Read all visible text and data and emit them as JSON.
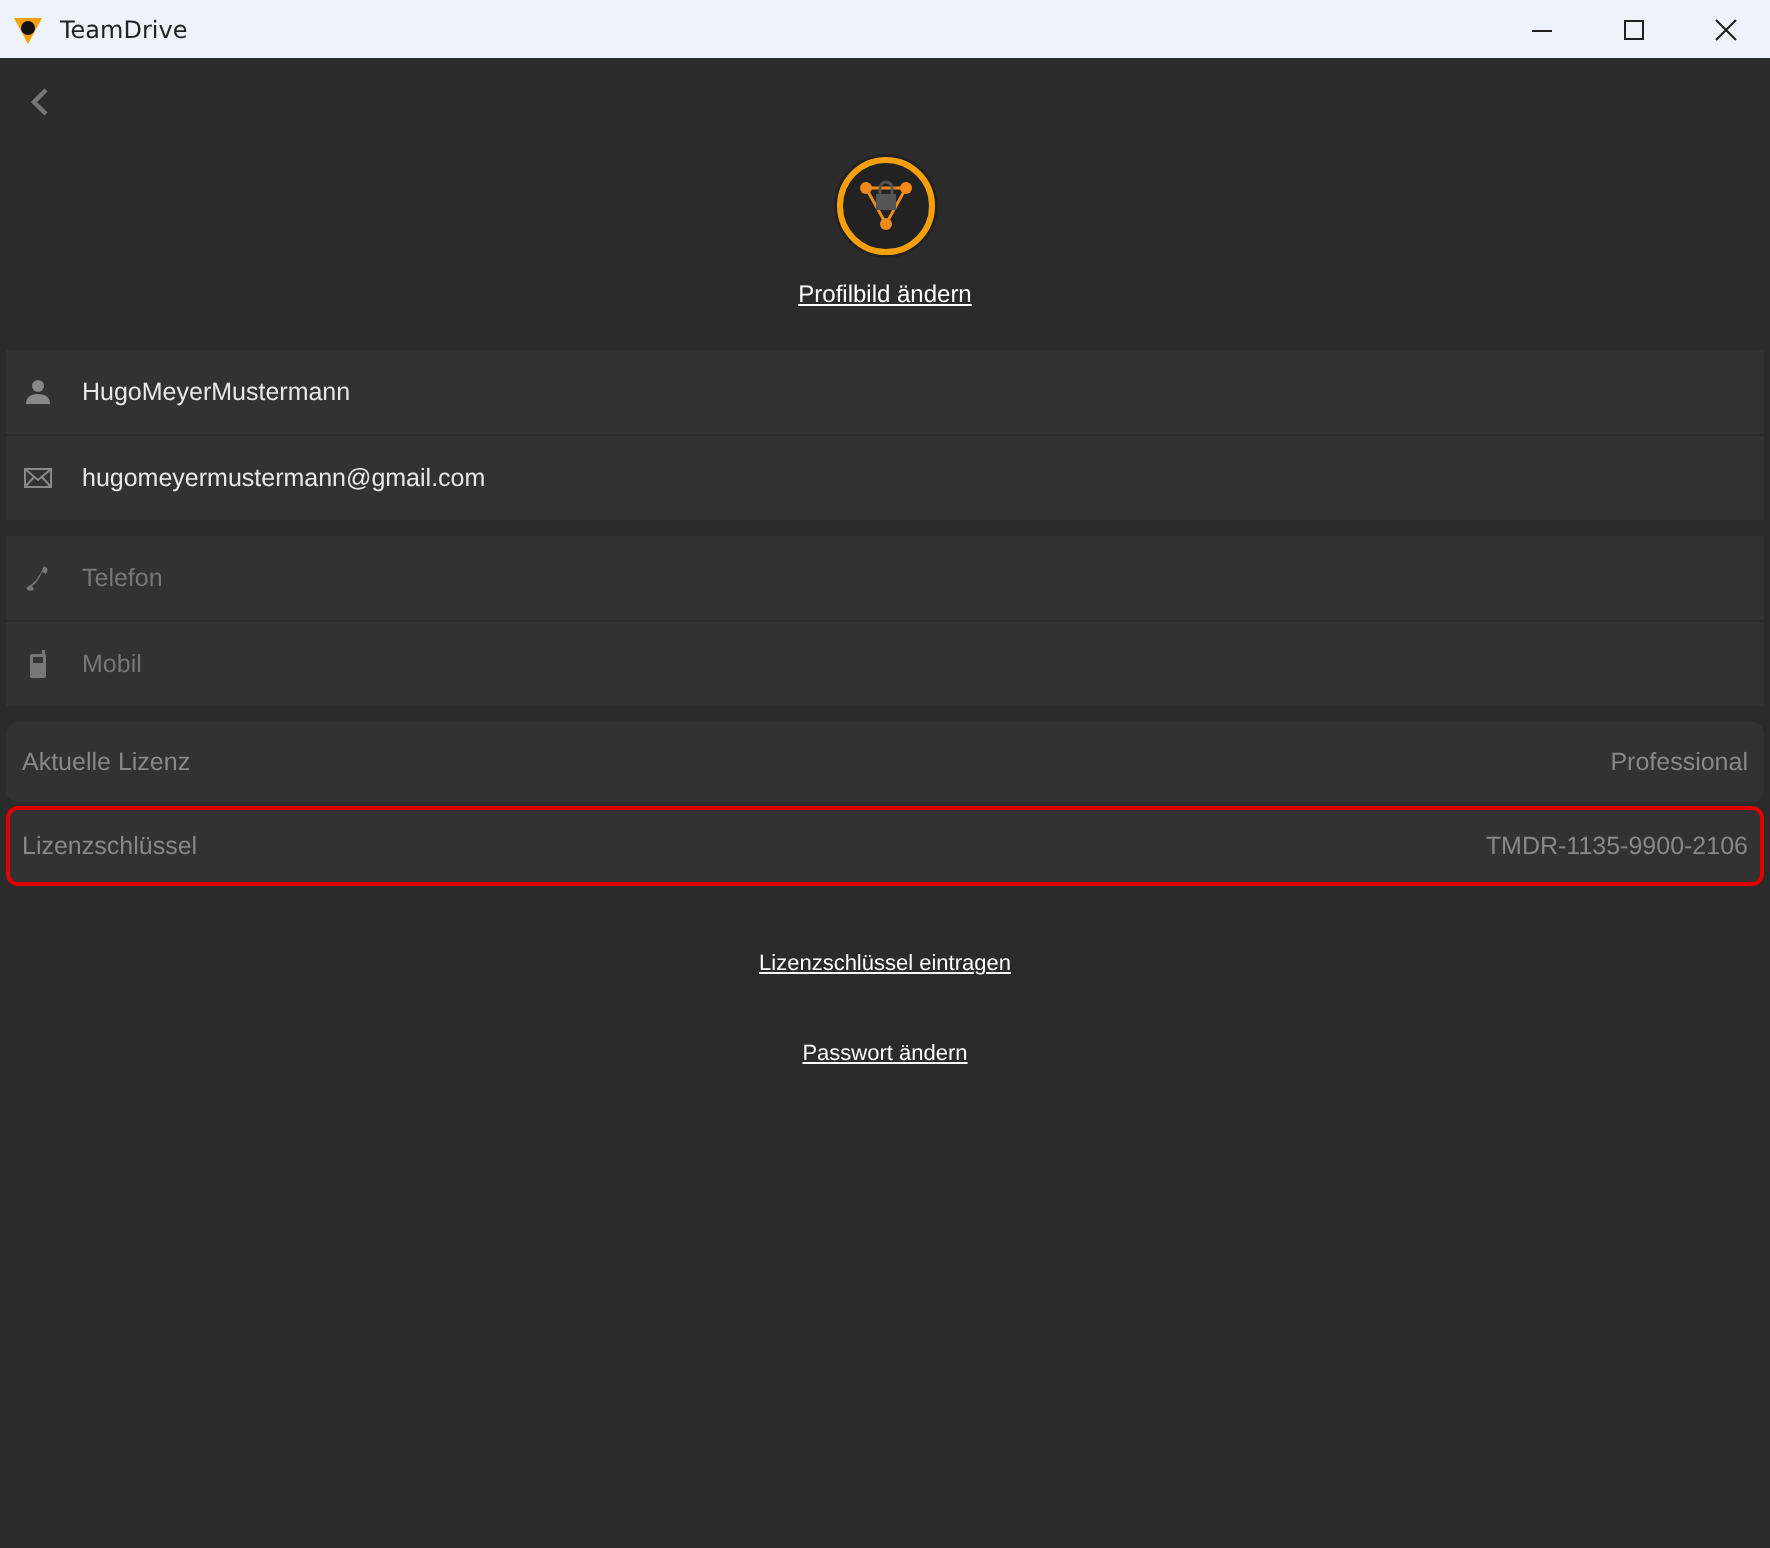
{
  "window": {
    "title": "TeamDrive"
  },
  "profile": {
    "change_picture_link": "Profilbild ändern"
  },
  "contact_groups": [
    [
      {
        "kind": "person",
        "value": "HugoMeyerMustermann"
      },
      {
        "kind": "mail",
        "value": "hugomeyermustermann@gmail.com"
      }
    ],
    [
      {
        "kind": "phone",
        "placeholder": "Telefon"
      },
      {
        "kind": "mobile",
        "placeholder": "Mobil"
      }
    ]
  ],
  "license_rows": [
    {
      "label": "Aktuelle Lizenz",
      "value": "Professional",
      "highlighted": false
    },
    {
      "label": "Lizenzschlüssel",
      "value": "TMDR-1135-9900-2106",
      "highlighted": true
    }
  ],
  "links": [
    "Lizenzschlüssel eintragen",
    "Passwort ändern"
  ]
}
